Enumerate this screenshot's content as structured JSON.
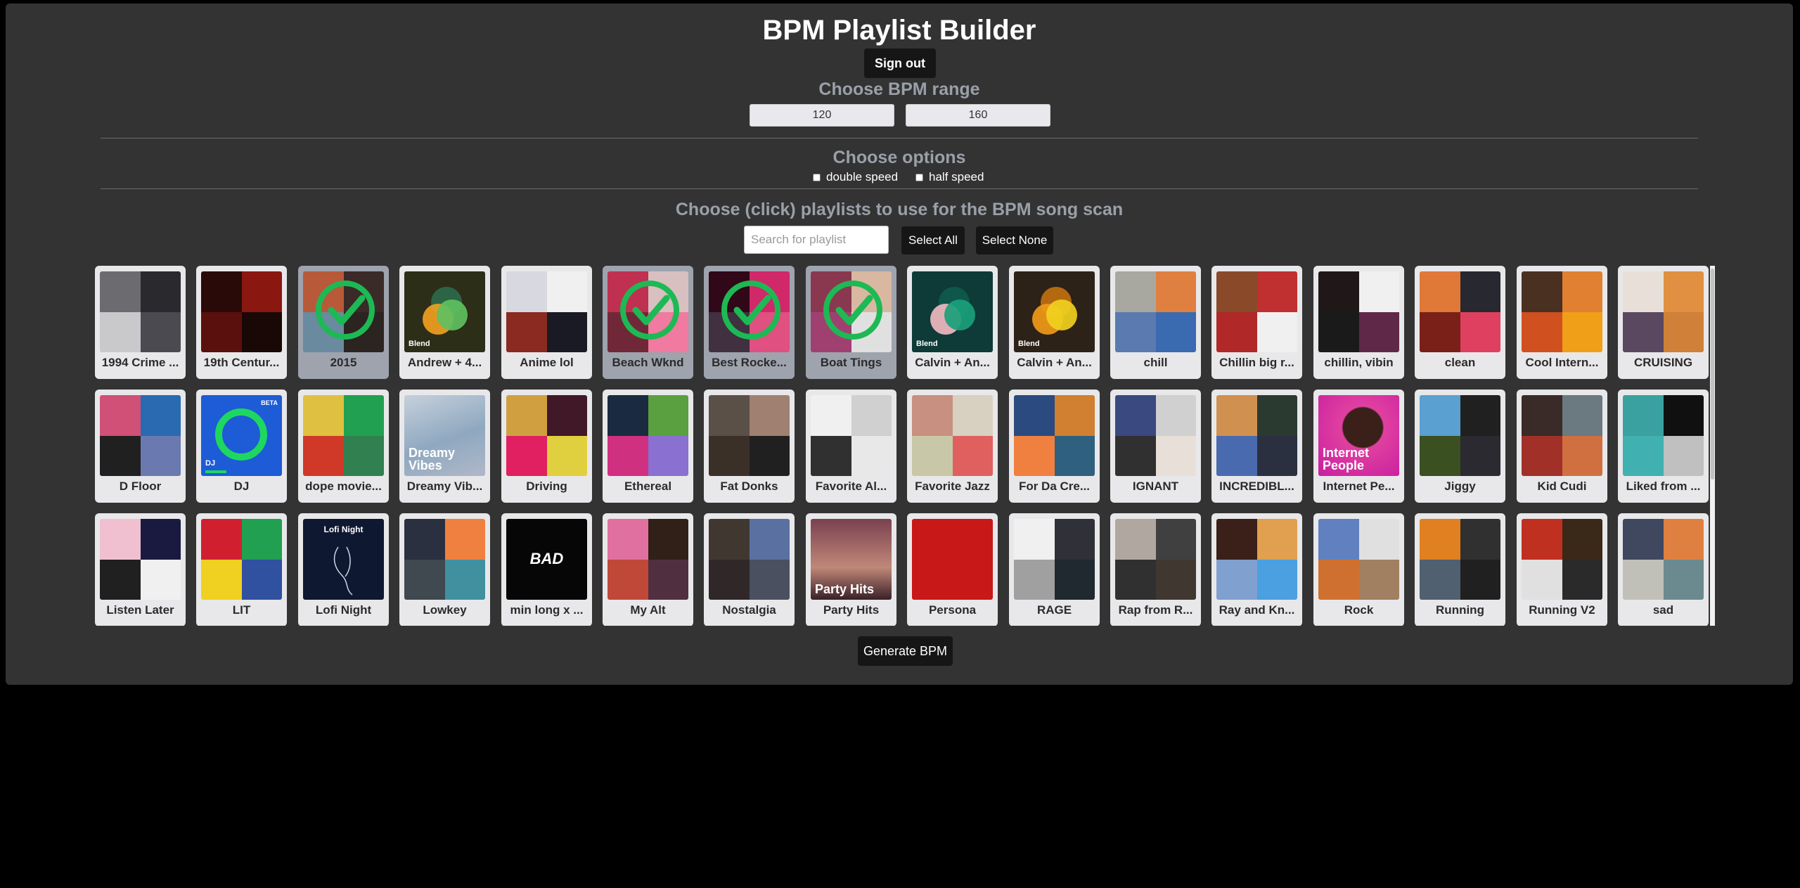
{
  "app": {
    "title": "BPM Playlist Builder",
    "sign_out": "Sign out"
  },
  "bpm": {
    "heading": "Choose BPM range",
    "min": "120",
    "max": "160"
  },
  "options": {
    "heading": "Choose options",
    "double_speed": "double speed",
    "half_speed": "half speed"
  },
  "playlists": {
    "heading": "Choose (click) playlists to use for the BPM song scan",
    "search_placeholder": "Search for playlist",
    "select_all": "Select All",
    "select_none": "Select None",
    "items": [
      {
        "name": "1994 Crime ...",
        "selected": false,
        "colors": [
          "#6b6b70",
          "#2a2a2e",
          "#c9c9cc",
          "#4a4a50"
        ]
      },
      {
        "name": "19th Centur...",
        "selected": false,
        "colors": [
          "#2a0a08",
          "#8a1810",
          "#5a100c",
          "#1a0806"
        ]
      },
      {
        "name": "2015",
        "selected": true,
        "colors": [
          "#b85a3a",
          "#3a2a28",
          "#6a8aa0",
          "#2c2420"
        ]
      },
      {
        "name": "Andrew + 4...",
        "selected": false,
        "blend": true,
        "blend_bg": "#2c2e18",
        "circles": [
          "#f0a020",
          "#60c060",
          "#2d6a4a"
        ],
        "label": "Blend",
        "colors": []
      },
      {
        "name": "Anime lol",
        "selected": false,
        "colors": [
          "#d8d8e0",
          "#f0f0f0",
          "#8a2a20",
          "#1a1a24"
        ]
      },
      {
        "name": "Beach Wknd",
        "selected": true,
        "colors": [
          "#c03050",
          "#d8c0c0",
          "#702838",
          "#f07aa0"
        ]
      },
      {
        "name": "Best Rocke...",
        "selected": true,
        "colors": [
          "#300818",
          "#d02868",
          "#403040",
          "#e05080"
        ]
      },
      {
        "name": "Boat Tings",
        "selected": true,
        "colors": [
          "#8a3850",
          "#d8b8a0",
          "#a04070",
          "#e0e0e0"
        ]
      },
      {
        "name": "Calvin + An...",
        "selected": false,
        "blend": true,
        "blend_bg": "#0e3a38",
        "circles": [
          "#f0b8c0",
          "#1aa07a",
          "#0e5a4c"
        ],
        "label": "Blend",
        "colors": []
      },
      {
        "name": "Calvin + An...",
        "selected": false,
        "blend": true,
        "blend_bg": "#2c2218",
        "circles": [
          "#f09a18",
          "#f0d020",
          "#c07010"
        ],
        "label": "Blend",
        "colors": []
      },
      {
        "name": "chill",
        "selected": false,
        "colors": [
          "#a8a8a0",
          "#e08040",
          "#5a7ab0",
          "#3a6ab0"
        ]
      },
      {
        "name": "Chillin big r...",
        "selected": false,
        "colors": [
          "#8a4a2a",
          "#c03030",
          "#b02828",
          "#f0f0f0"
        ]
      },
      {
        "name": "chillin, vibin",
        "selected": false,
        "colors": [
          "#201818",
          "#f0f0f0",
          "#1a1a1a",
          "#602848"
        ]
      },
      {
        "name": "clean",
        "selected": false,
        "colors": [
          "#e07838",
          "#282830",
          "#7a2018",
          "#e04060"
        ]
      },
      {
        "name": "Cool Intern...",
        "selected": false,
        "colors": [
          "#4a3020",
          "#e08030",
          "#d05020",
          "#f0a018"
        ]
      },
      {
        "name": "CRUISING",
        "selected": false,
        "colors": [
          "#e8e0d8",
          "#e09040",
          "#5a4860",
          "#d08038"
        ]
      },
      {
        "name": "D Floor",
        "selected": false,
        "colors": [
          "#d05078",
          "#2a6ab0",
          "#202020",
          "#6a7ab0"
        ]
      },
      {
        "name": "DJ",
        "selected": false,
        "dj": true,
        "label": "DJ",
        "badge": "BETA",
        "colors": []
      },
      {
        "name": "dope movie...",
        "selected": false,
        "colors": [
          "#e0c040",
          "#20a050",
          "#d03828",
          "#308050"
        ]
      },
      {
        "name": "Dreamy Vib...",
        "selected": false,
        "dreamy": true,
        "label": "Dreamy Vibes",
        "colors": []
      },
      {
        "name": "Driving",
        "selected": false,
        "colors": [
          "#d0a040",
          "#401828",
          "#e02060",
          "#e0d040"
        ]
      },
      {
        "name": "Ethereal",
        "selected": false,
        "colors": [
          "#1a2a40",
          "#5aa040",
          "#d03080",
          "#8a70d0"
        ]
      },
      {
        "name": "Fat Donks",
        "selected": false,
        "colors": [
          "#5a5048",
          "#a08070",
          "#3a3028",
          "#202020"
        ]
      },
      {
        "name": "Favorite Al...",
        "selected": false,
        "colors": [
          "#f0f0f0",
          "#d0d0d0",
          "#303030",
          "#e8e8e8"
        ]
      },
      {
        "name": "Favorite Jazz",
        "selected": false,
        "colors": [
          "#c89080",
          "#d8d0c0",
          "#c8c8a8",
          "#e06060"
        ]
      },
      {
        "name": "For Da Cre...",
        "selected": false,
        "colors": [
          "#2a4a80",
          "#d08030",
          "#f08040",
          "#306080"
        ]
      },
      {
        "name": "IGNANT",
        "selected": false,
        "colors": [
          "#3a4a80",
          "#d0d0d0",
          "#303030",
          "#e8e0d8"
        ]
      },
      {
        "name": "INCREDIBL...",
        "selected": false,
        "colors": [
          "#d09050",
          "#2a3a30",
          "#4a6ab0",
          "#2a3040"
        ]
      },
      {
        "name": "Internet Pe...",
        "selected": false,
        "internet": true,
        "label": "Internet People",
        "colors": []
      },
      {
        "name": "Jiggy",
        "selected": false,
        "colors": [
          "#5aa0d0",
          "#202020",
          "#3a5020",
          "#2a2a30"
        ]
      },
      {
        "name": "Kid Cudi",
        "selected": false,
        "colors": [
          "#3a2a28",
          "#6a7a80",
          "#a03028",
          "#d07040"
        ]
      },
      {
        "name": "Liked from ...",
        "selected": false,
        "colors": [
          "#3aa0a0",
          "#101010",
          "#40b0b0",
          "#c0c0c0"
        ]
      },
      {
        "name": "Listen Later",
        "selected": false,
        "colors": [
          "#f0c0d0",
          "#1a1a40",
          "#202020",
          "#f0f0f0"
        ]
      },
      {
        "name": "LIT",
        "selected": false,
        "colors": [
          "#d02030",
          "#20a050",
          "#f0d020",
          "#3050a0"
        ]
      },
      {
        "name": "Lofi Night",
        "selected": false,
        "lofi": true,
        "label": "Lofi Night",
        "colors": []
      },
      {
        "name": "Lowkey",
        "selected": false,
        "colors": [
          "#2a3040",
          "#f08040",
          "#404850",
          "#4090a0"
        ]
      },
      {
        "name": "min long x ...",
        "selected": false,
        "single": "#060606",
        "label": "BAD",
        "colors": []
      },
      {
        "name": "My Alt",
        "selected": false,
        "colors": [
          "#e070a0",
          "#302018",
          "#c04838",
          "#503040"
        ]
      },
      {
        "name": "Nostalgia",
        "selected": false,
        "colors": [
          "#403830",
          "#5a70a0",
          "#302828",
          "#4a5060"
        ]
      },
      {
        "name": "Party Hits",
        "selected": false,
        "party": true,
        "label": "Party Hits",
        "colors": []
      },
      {
        "name": "Persona",
        "selected": false,
        "single": "#c81818",
        "colors": []
      },
      {
        "name": "RAGE",
        "selected": false,
        "colors": [
          "#f0f0f0",
          "#303038",
          "#a0a0a0",
          "#202830"
        ]
      },
      {
        "name": "Rap from R...",
        "selected": false,
        "colors": [
          "#b0a8a0",
          "#404040",
          "#303030",
          "#403830"
        ]
      },
      {
        "name": "Ray and Kn...",
        "selected": false,
        "colors": [
          "#3a2018",
          "#e0a050",
          "#80a0d0",
          "#4aa0e0"
        ]
      },
      {
        "name": "Rock",
        "selected": false,
        "colors": [
          "#6080c0",
          "#e0e0e0",
          "#d07030",
          "#a08060"
        ]
      },
      {
        "name": "Running",
        "selected": false,
        "colors": [
          "#e08020",
          "#303030",
          "#506070",
          "#202020"
        ]
      },
      {
        "name": "Running V2",
        "selected": false,
        "colors": [
          "#c03020",
          "#3a2818",
          "#e0e0e0",
          "#2a2a2a"
        ]
      },
      {
        "name": "sad",
        "selected": false,
        "colors": [
          "#404860",
          "#e08040",
          "#c0c0b8",
          "#6a8a90"
        ]
      }
    ]
  },
  "generate": "Generate BPM",
  "theme": {
    "panel": "#333333",
    "card": "#e8e8ea",
    "card_selected": "#9ea3ad",
    "check": "#1db954"
  }
}
